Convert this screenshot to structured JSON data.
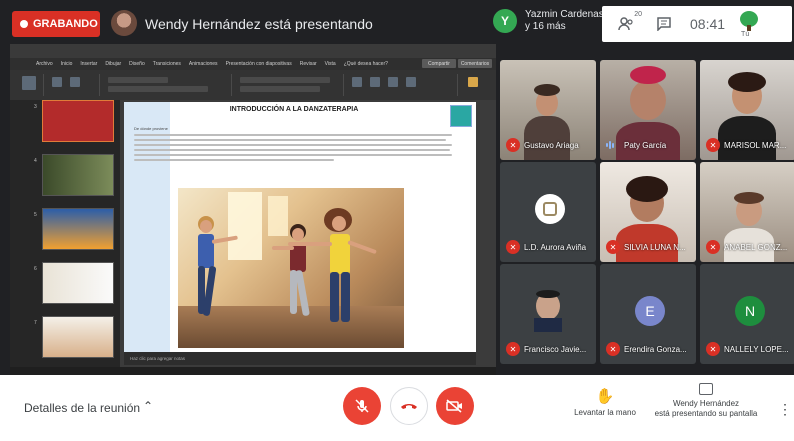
{
  "recording": {
    "label": "GRABANDO"
  },
  "presenter": {
    "title": "Wendy Hernández está presentando"
  },
  "participants": {
    "avatar_letter": "Y",
    "line1": "Yazmin Cardenas",
    "line2": "y 16 más"
  },
  "topright": {
    "people_count": "20",
    "time": "08:41",
    "you_label": "Tú"
  },
  "slide": {
    "title": "INTRODUCCIÓN A LA DANZATERAPIA",
    "subtitle": "De dónde proviene",
    "notes": "Haz clic para agregar notas",
    "ribbon_menu": [
      "Archivo",
      "Inicio",
      "Insertar",
      "Dibujar",
      "Diseño",
      "Transiciones",
      "Animaciones",
      "Presentación con diapositivas",
      "Revisar",
      "Vista",
      "¿Qué desea hacer?"
    ],
    "share": "Compartir",
    "comments": "Comentarios",
    "thumb_numbers": [
      "3",
      "4",
      "5",
      "6",
      "7"
    ]
  },
  "tiles": [
    {
      "name": "Gustavo Ariaga",
      "status": "muted"
    },
    {
      "name": "Paty García",
      "status": "speaking"
    },
    {
      "name": "MARISOL MAR...",
      "status": "muted"
    },
    {
      "name": "L.D. Aurora Aviña",
      "status": "muted"
    },
    {
      "name": "SILVIA LUNA N...",
      "status": "muted"
    },
    {
      "name": "ANABEL GONZ...",
      "status": "muted"
    },
    {
      "name": "Francisco Javie...",
      "status": "muted"
    },
    {
      "name": "Erendira Gonza...",
      "status": "muted",
      "letter": "E",
      "color": "#7986cb"
    },
    {
      "name": "NALLELY LOPE...",
      "status": "muted",
      "letter": "N",
      "color": "#1e8e3e"
    }
  ],
  "bottom": {
    "details": "Detalles de la reunión",
    "raise_hand": "Levantar la mano",
    "presenting_line1": "Wendy Hernández",
    "presenting_line2": "está presentando su pantalla"
  },
  "colors": {
    "red": "#ea4335",
    "record": "#d93025",
    "bg": "#202124"
  }
}
